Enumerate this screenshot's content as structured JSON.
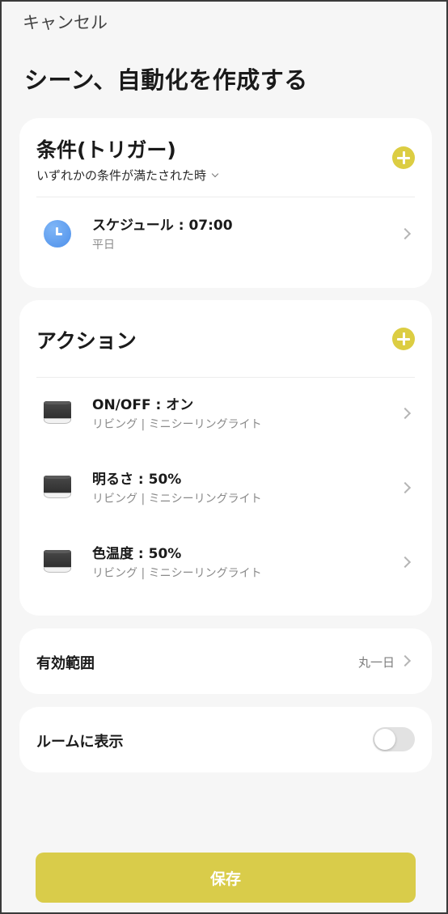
{
  "header": {
    "cancel_label": "キャンセル",
    "title": "シーン、自動化を作成する"
  },
  "condition": {
    "title": "条件(トリガー)",
    "mode_label": "いずれかの条件が満たされた時",
    "items": [
      {
        "icon": "clock-icon",
        "main": "スケジュール : 07:00",
        "sub": "平日"
      }
    ]
  },
  "action": {
    "title": "アクション",
    "items": [
      {
        "icon": "ceiling-light-icon",
        "main": "ON/OFF : オン",
        "sub": "リビング | ミニシーリングライト"
      },
      {
        "icon": "ceiling-light-icon",
        "main": "明るさ : 50%",
        "sub": "リビング | ミニシーリングライト"
      },
      {
        "icon": "ceiling-light-icon",
        "main": "色温度 : 50%",
        "sub": "リビング | ミニシーリングライト"
      }
    ]
  },
  "validity": {
    "label": "有効範囲",
    "value": "丸一日"
  },
  "room_display": {
    "label": "ルームに表示",
    "enabled": false
  },
  "footer": {
    "save_label": "保存"
  },
  "colors": {
    "accent": "#dccd42",
    "save_button": "#d9cc4a",
    "clock_icon": "#5a9cf0",
    "background": "#f6f6f6"
  }
}
